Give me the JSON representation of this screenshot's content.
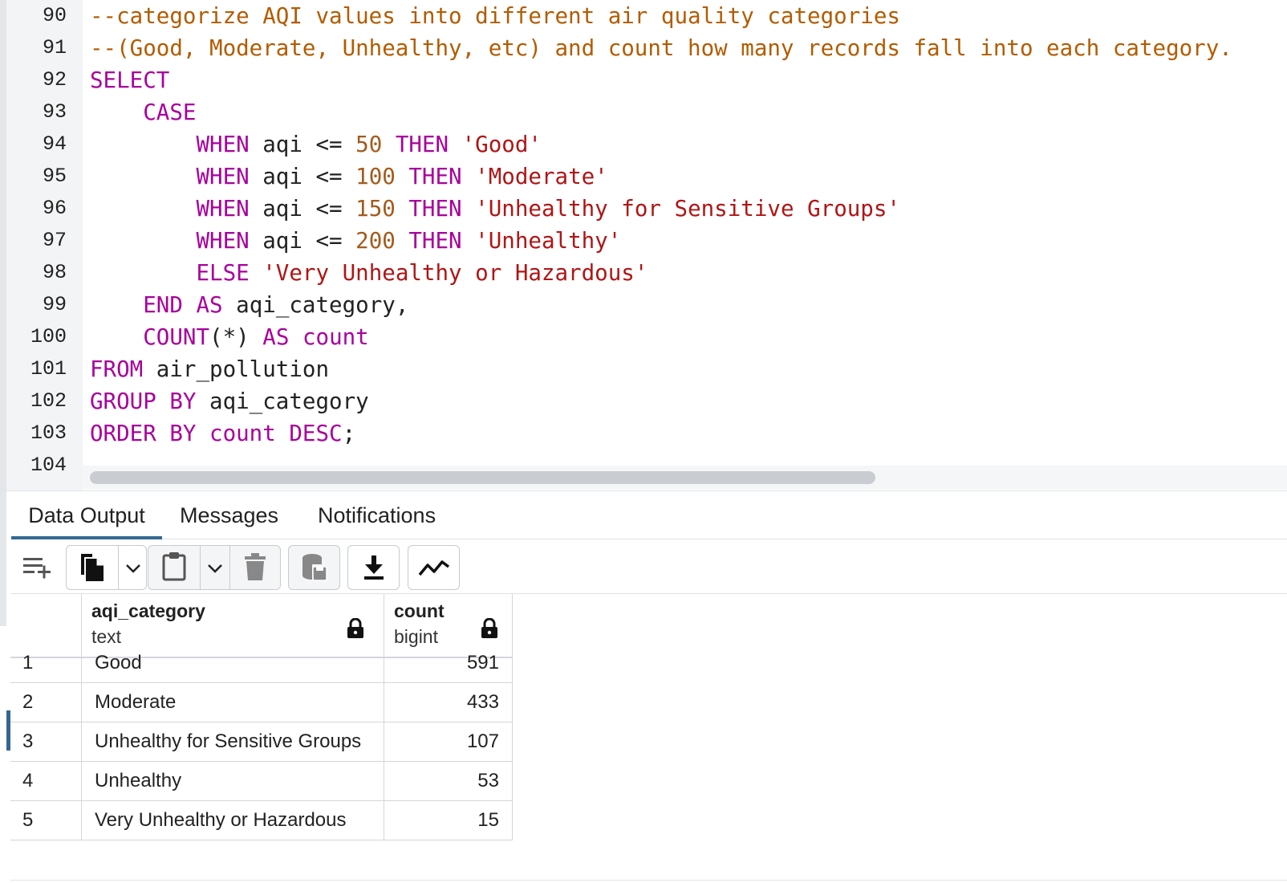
{
  "editor": {
    "lines": [
      {
        "n": "90",
        "tokens": [
          {
            "t": "--categorize AQI values into different air quality categories",
            "c": "comment"
          }
        ]
      },
      {
        "n": "91",
        "tokens": [
          {
            "t": "--(Good, Moderate, Unhealthy, etc) and count how many records fall into each category.",
            "c": "comment"
          }
        ]
      },
      {
        "n": "92",
        "tokens": [
          {
            "t": "SELECT",
            "c": "kw"
          }
        ]
      },
      {
        "n": "93",
        "tokens": [
          {
            "t": "    ",
            "c": "punc"
          },
          {
            "t": "CASE",
            "c": "kw"
          }
        ]
      },
      {
        "n": "94",
        "tokens": [
          {
            "t": "        ",
            "c": "punc"
          },
          {
            "t": "WHEN",
            "c": "kw"
          },
          {
            "t": " aqi <= ",
            "c": "punc"
          },
          {
            "t": "50",
            "c": "num"
          },
          {
            "t": " ",
            "c": "punc"
          },
          {
            "t": "THEN",
            "c": "kw"
          },
          {
            "t": " ",
            "c": "punc"
          },
          {
            "t": "'Good'",
            "c": "str"
          }
        ]
      },
      {
        "n": "95",
        "tokens": [
          {
            "t": "        ",
            "c": "punc"
          },
          {
            "t": "WHEN",
            "c": "kw"
          },
          {
            "t": " aqi <= ",
            "c": "punc"
          },
          {
            "t": "100",
            "c": "num"
          },
          {
            "t": " ",
            "c": "punc"
          },
          {
            "t": "THEN",
            "c": "kw"
          },
          {
            "t": " ",
            "c": "punc"
          },
          {
            "t": "'Moderate'",
            "c": "str"
          }
        ]
      },
      {
        "n": "96",
        "tokens": [
          {
            "t": "        ",
            "c": "punc"
          },
          {
            "t": "WHEN",
            "c": "kw"
          },
          {
            "t": " aqi <= ",
            "c": "punc"
          },
          {
            "t": "150",
            "c": "num"
          },
          {
            "t": " ",
            "c": "punc"
          },
          {
            "t": "THEN",
            "c": "kw"
          },
          {
            "t": " ",
            "c": "punc"
          },
          {
            "t": "'Unhealthy for Sensitive Groups'",
            "c": "str"
          }
        ]
      },
      {
        "n": "97",
        "tokens": [
          {
            "t": "        ",
            "c": "punc"
          },
          {
            "t": "WHEN",
            "c": "kw"
          },
          {
            "t": " aqi <= ",
            "c": "punc"
          },
          {
            "t": "200",
            "c": "num"
          },
          {
            "t": " ",
            "c": "punc"
          },
          {
            "t": "THEN",
            "c": "kw"
          },
          {
            "t": " ",
            "c": "punc"
          },
          {
            "t": "'Unhealthy'",
            "c": "str"
          }
        ]
      },
      {
        "n": "98",
        "tokens": [
          {
            "t": "        ",
            "c": "punc"
          },
          {
            "t": "ELSE",
            "c": "kw"
          },
          {
            "t": " ",
            "c": "punc"
          },
          {
            "t": "'Very Unhealthy or Hazardous'",
            "c": "str"
          }
        ]
      },
      {
        "n": "99",
        "tokens": [
          {
            "t": "    ",
            "c": "punc"
          },
          {
            "t": "END",
            "c": "kw"
          },
          {
            "t": " ",
            "c": "punc"
          },
          {
            "t": "AS",
            "c": "kw"
          },
          {
            "t": " aqi_category,",
            "c": "punc"
          }
        ]
      },
      {
        "n": "100",
        "tokens": [
          {
            "t": "    ",
            "c": "punc"
          },
          {
            "t": "COUNT",
            "c": "kw"
          },
          {
            "t": "(*) ",
            "c": "punc"
          },
          {
            "t": "AS",
            "c": "kw"
          },
          {
            "t": " ",
            "c": "punc"
          },
          {
            "t": "count",
            "c": "kw"
          }
        ]
      },
      {
        "n": "101",
        "tokens": [
          {
            "t": "FROM",
            "c": "kw"
          },
          {
            "t": " air_pollution",
            "c": "punc"
          }
        ]
      },
      {
        "n": "102",
        "tokens": [
          {
            "t": "GROUP BY",
            "c": "kw"
          },
          {
            "t": " aqi_category",
            "c": "punc"
          }
        ]
      },
      {
        "n": "103",
        "tokens": [
          {
            "t": "ORDER BY",
            "c": "kw"
          },
          {
            "t": " ",
            "c": "punc"
          },
          {
            "t": "count",
            "c": "kw"
          },
          {
            "t": " ",
            "c": "punc"
          },
          {
            "t": "DESC",
            "c": "kw"
          },
          {
            "t": ";",
            "c": "punc"
          }
        ]
      },
      {
        "n": "104",
        "tokens": []
      }
    ]
  },
  "tabs": {
    "data_output": "Data Output",
    "messages": "Messages",
    "notifications": "Notifications",
    "active": "Data Output"
  },
  "toolbar": {
    "icons": [
      "add-row-icon",
      "copy-icon",
      "chevron-down-icon",
      "paste-icon",
      "chevron-down-icon",
      "delete-icon",
      "save-data-icon",
      "download-icon",
      "graph-icon"
    ]
  },
  "grid": {
    "columns": [
      {
        "name": "aqi_category",
        "type": "text"
      },
      {
        "name": "count",
        "type": "bigint"
      }
    ],
    "rows": [
      {
        "n": "1",
        "aqi_category": "Good",
        "count": "591"
      },
      {
        "n": "2",
        "aqi_category": "Moderate",
        "count": "433"
      },
      {
        "n": "3",
        "aqi_category": "Unhealthy for Sensitive Groups",
        "count": "107"
      },
      {
        "n": "4",
        "aqi_category": "Unhealthy",
        "count": "53"
      },
      {
        "n": "5",
        "aqi_category": "Very Unhealthy or Hazardous",
        "count": "15"
      }
    ],
    "selected_row": "2"
  },
  "colors": {
    "keyword": "#a8009c",
    "comment": "#b25c00",
    "string": "#b01515",
    "number": "#a45a1b",
    "accent": "#336791"
  }
}
